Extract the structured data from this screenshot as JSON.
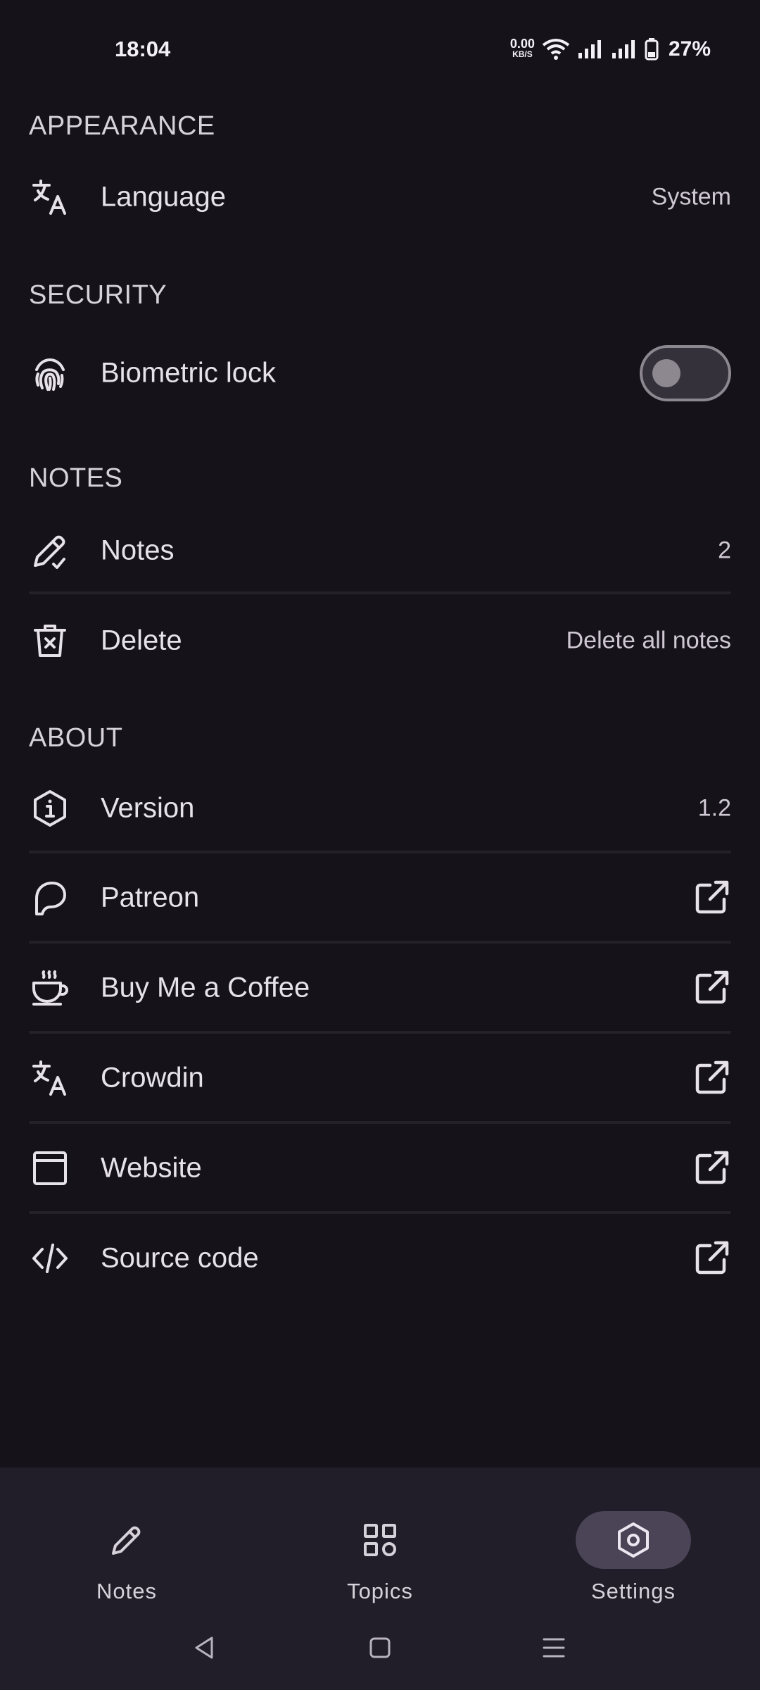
{
  "status_bar": {
    "time": "18:04",
    "net_speed_value": "0.00",
    "net_speed_unit": "KB/S",
    "battery_percent": "27%"
  },
  "sections": {
    "appearance": "APPEARANCE",
    "security": "SECURITY",
    "notes": "NOTES",
    "about": "ABOUT"
  },
  "rows": {
    "language": {
      "label": "Language",
      "value": "System"
    },
    "biometric": {
      "label": "Biometric lock",
      "enabled": false
    },
    "notes": {
      "label": "Notes",
      "value": "2"
    },
    "delete": {
      "label": "Delete",
      "value": "Delete all notes"
    },
    "version": {
      "label": "Version",
      "value": "1.2"
    },
    "patreon": {
      "label": "Patreon"
    },
    "coffee": {
      "label": "Buy Me a Coffee"
    },
    "crowdin": {
      "label": "Crowdin"
    },
    "website": {
      "label": "Website"
    },
    "source": {
      "label": "Source code"
    }
  },
  "bottom_nav": {
    "items": [
      {
        "label": "Notes",
        "icon": "pencil-icon"
      },
      {
        "label": "Topics",
        "icon": "grid-icon"
      },
      {
        "label": "Settings",
        "icon": "settings-hexagon-icon",
        "active": true
      }
    ]
  },
  "colors": {
    "background": "#15121a",
    "nav_background": "#211d29",
    "active_pill": "#4a4456",
    "text": "#e7e1ea"
  }
}
